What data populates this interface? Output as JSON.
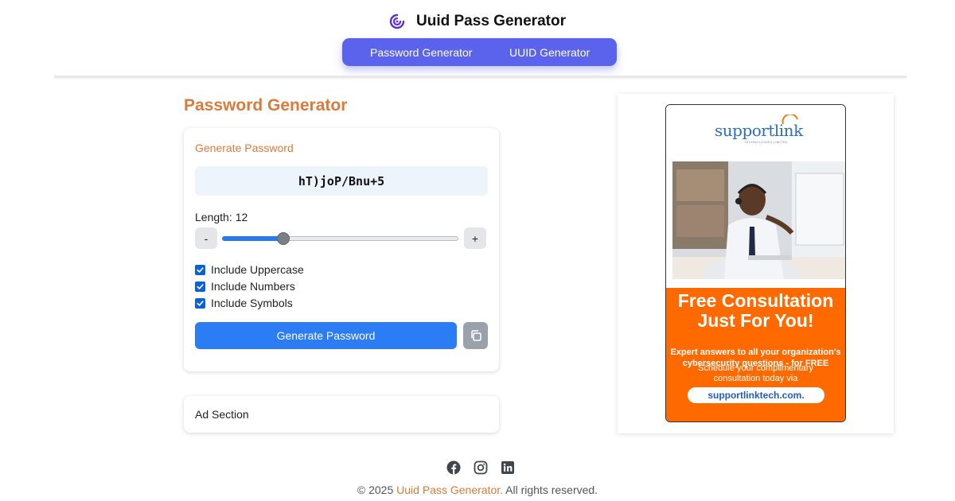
{
  "header": {
    "logo_icon": "swirl-logo-icon",
    "title": "Uuid Pass Generator"
  },
  "nav": {
    "tabs": [
      {
        "label": "Password Generator"
      },
      {
        "label": "UUID Generator"
      }
    ]
  },
  "main": {
    "page_title": "Password Generator",
    "generator": {
      "title": "Generate Password",
      "password": "hT)joP/Bnu+5",
      "length_label": "Length:",
      "length_value": "12",
      "slider_fraction": 0.26,
      "minus_label": "-",
      "plus_label": "+",
      "options": [
        {
          "label": "Include Uppercase",
          "checked": true
        },
        {
          "label": "Include Numbers",
          "checked": true
        },
        {
          "label": "Include Symbols",
          "checked": true
        }
      ],
      "generate_label": "Generate Password",
      "copy_icon": "copy-icon"
    },
    "ad_section_label": "Ad Section"
  },
  "ad": {
    "brand": "supportlink",
    "brand_sub": "TECHNOLOGIES LIMITED",
    "headline_1": "Free Consultation",
    "headline_2": "Just For You!",
    "sub_1": "Expert answers to all your organization's",
    "sub_2": "cybersecurity questions - for FREE",
    "sched_1": "Schedule your complimentary",
    "sched_2": "consultation today via",
    "url": "supportlinktech.com."
  },
  "footer": {
    "social": [
      "facebook-icon",
      "instagram-icon",
      "linkedin-icon"
    ],
    "copyright_prefix": "© 2025 ",
    "copyright_brand": "Uuid Pass Generator.",
    "copyright_suffix": " All rights reserved."
  },
  "colors": {
    "accent_orange": "#dd7a3a",
    "nav_bg": "#5b63ec",
    "primary_button": "#2c7cf6",
    "ad_orange": "#ff6a00"
  }
}
